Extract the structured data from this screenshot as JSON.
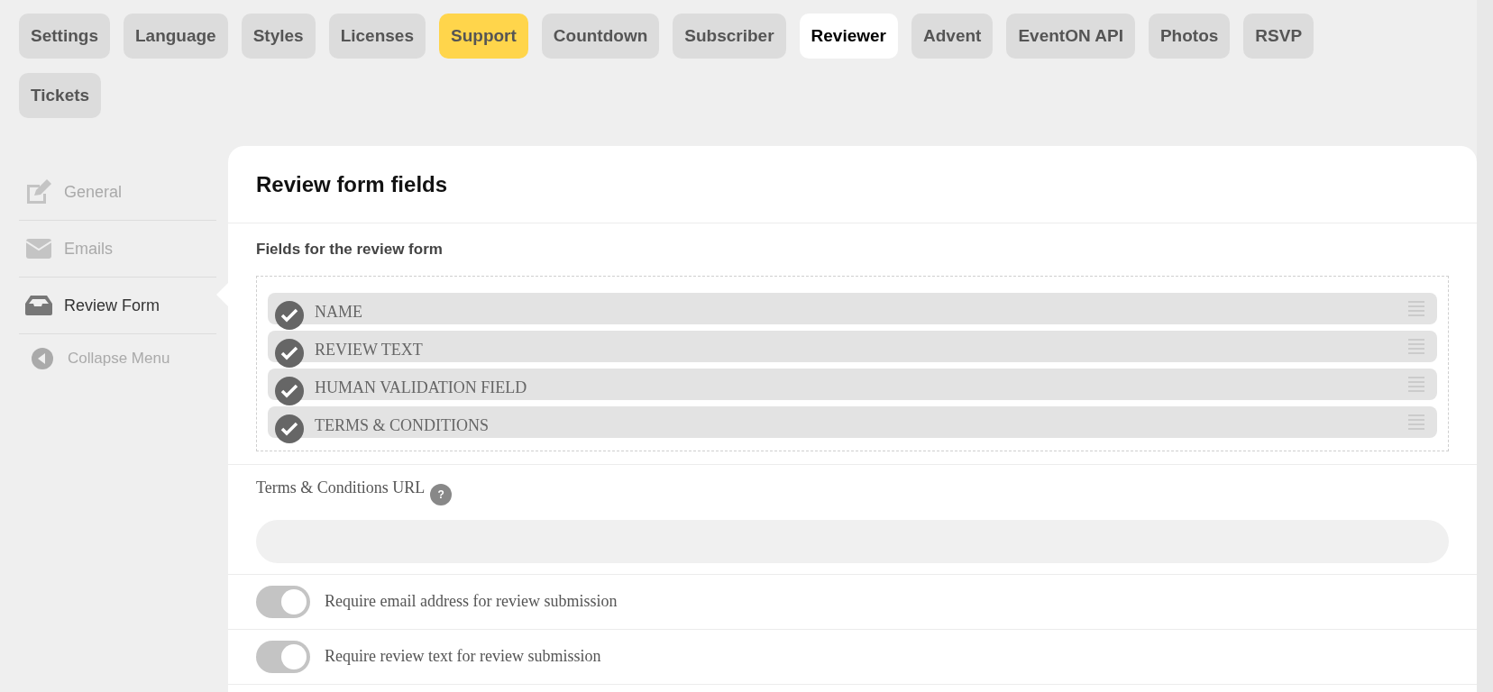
{
  "tabs": [
    {
      "label": "Settings",
      "selected": false,
      "kind": "plain"
    },
    {
      "label": "Language",
      "selected": false,
      "kind": "plain"
    },
    {
      "label": "Styles",
      "selected": false,
      "kind": "plain"
    },
    {
      "label": "Licenses",
      "selected": false,
      "kind": "plain"
    },
    {
      "label": "Support",
      "selected": false,
      "kind": "highlight"
    },
    {
      "label": "Countdown",
      "selected": false,
      "kind": "plain"
    },
    {
      "label": "Subscriber",
      "selected": false,
      "kind": "plain"
    },
    {
      "label": "Reviewer",
      "selected": true,
      "kind": "plain"
    },
    {
      "label": "Advent",
      "selected": false,
      "kind": "plain"
    },
    {
      "label": "EventON API",
      "selected": false,
      "kind": "plain"
    },
    {
      "label": "Photos",
      "selected": false,
      "kind": "plain"
    },
    {
      "label": "RSVP",
      "selected": false,
      "kind": "plain"
    },
    {
      "label": "Tickets",
      "selected": false,
      "kind": "plain"
    }
  ],
  "sidebar": {
    "items": [
      {
        "label": "General",
        "kind": "edit",
        "selected": false
      },
      {
        "label": "Emails",
        "kind": "mail",
        "selected": false
      },
      {
        "label": "Review Form",
        "kind": "inbox",
        "selected": true
      }
    ],
    "collapse": "Collapse Menu"
  },
  "panel": {
    "title": "Review form fields",
    "fields_label": "Fields for the review form",
    "fields": [
      {
        "label": "NAME",
        "checked": true
      },
      {
        "label": "REVIEW TEXT",
        "checked": true
      },
      {
        "label": "HUMAN VALIDATION FIELD",
        "checked": true
      },
      {
        "label": "TERMS & CONDITIONS",
        "checked": true
      }
    ],
    "url_label": "Terms & Conditions URL",
    "help": "?",
    "toggles": [
      {
        "label": "Require email address for review submission",
        "on": true
      },
      {
        "label": "Require review text for review submission",
        "on": true
      }
    ]
  }
}
